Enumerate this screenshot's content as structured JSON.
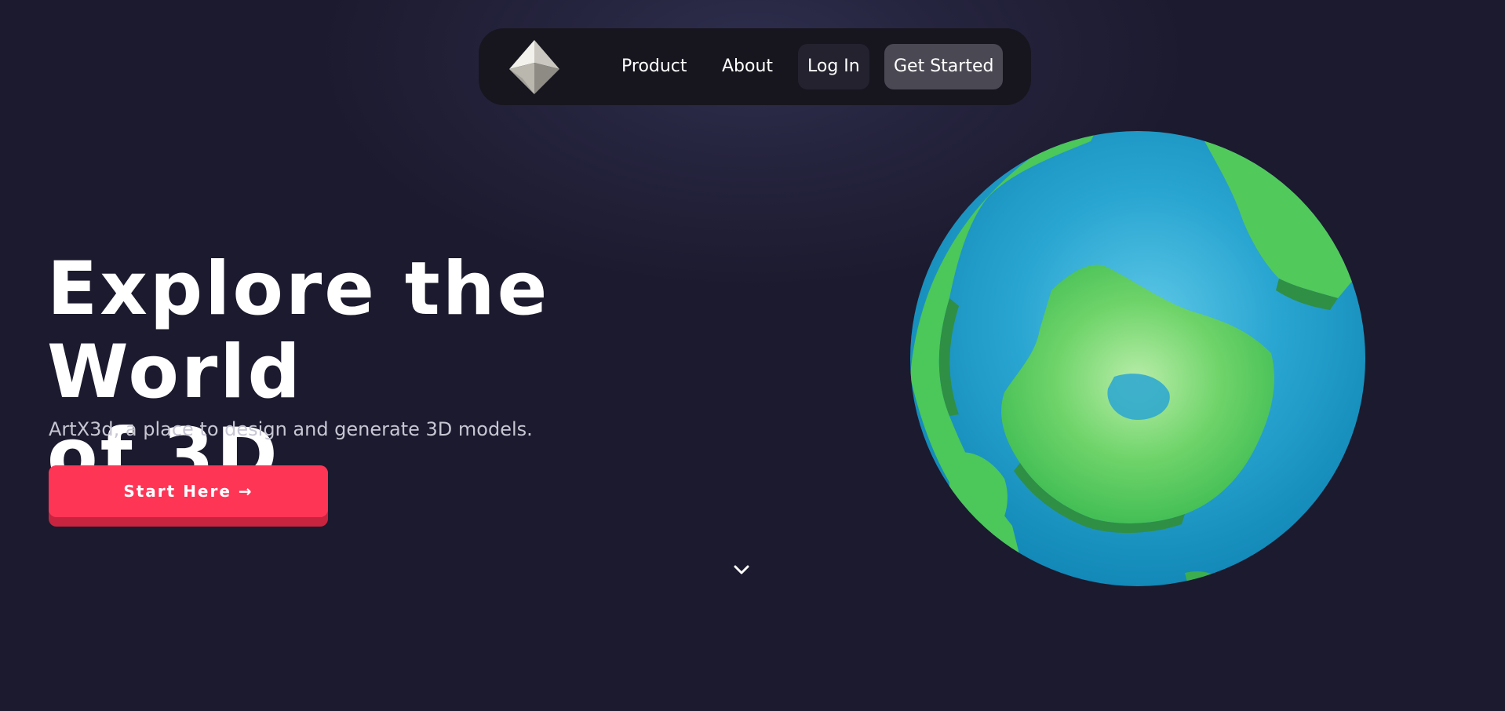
{
  "nav": {
    "logo_icon": "diamond-icon",
    "links": [
      {
        "label": "Product"
      },
      {
        "label": "About"
      }
    ],
    "login_label": "Log In",
    "get_started_label": "Get Started"
  },
  "hero": {
    "title_line1": "Explore the World",
    "title_line2": "of 3D",
    "subtitle": "ArtX3d, a place to design and generate 3D models.",
    "cta_label": "Start Here →",
    "scroll_icon": "chevron-down-icon",
    "globe_icon": "globe-icon"
  },
  "colors": {
    "background": "#1c1a2e",
    "nav_background": "#17161f",
    "cta": "#ff3556",
    "ocean": "#1a9ac8",
    "land": "#4fc95a"
  }
}
